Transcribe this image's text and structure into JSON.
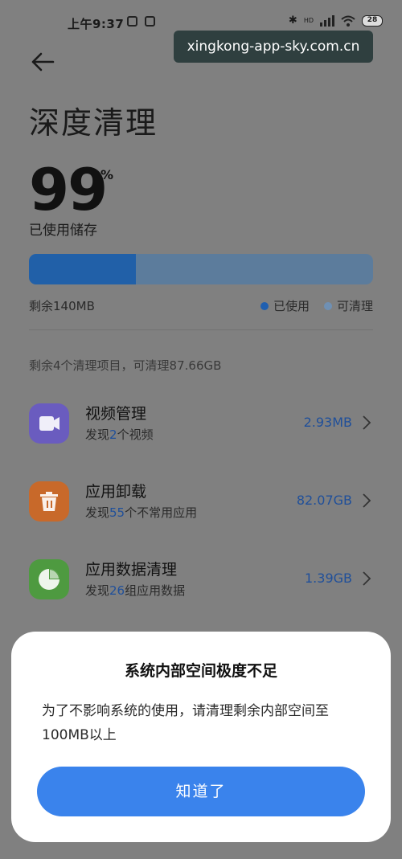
{
  "status_bar": {
    "time": "上午9:37",
    "battery": "28",
    "network_label": "HD"
  },
  "watermark": "xingkong-app-sky.com.cn",
  "header": {
    "title": "深度清理"
  },
  "storage": {
    "percent_used": "99",
    "percent_sign": "%",
    "used_label": "已使用储存",
    "remaining": "剩余140MB",
    "used_fraction": 0.31,
    "legend": {
      "used": "已使用",
      "cleanable": "可清理",
      "used_color": "#1f5fb0",
      "cleanable_color": "#6f90b4"
    }
  },
  "summary": "剩余4个清理项目，可清理87.66GB",
  "items": [
    {
      "name": "视频管理",
      "desc_prefix": "发现",
      "desc_count": "2",
      "desc_suffix": "个视频",
      "size": "2.93MB",
      "icon": "video-icon",
      "color": "#6a5cbf"
    },
    {
      "name": "应用卸载",
      "desc_prefix": "发现",
      "desc_count": "55",
      "desc_suffix": "个不常用应用",
      "size": "82.07GB",
      "icon": "trash-icon",
      "color": "#c8692a"
    },
    {
      "name": "应用数据清理",
      "desc_prefix": "发现",
      "desc_count": "26",
      "desc_suffix": "组应用数据",
      "size": "1.39GB",
      "icon": "pie-chart-icon",
      "color": "#4e9a40"
    }
  ],
  "dialog": {
    "title": "系统内部空间极度不足",
    "message": "为了不影响系统的使用，请清理剩余内部空间至100MB以上",
    "button": "知道了"
  }
}
